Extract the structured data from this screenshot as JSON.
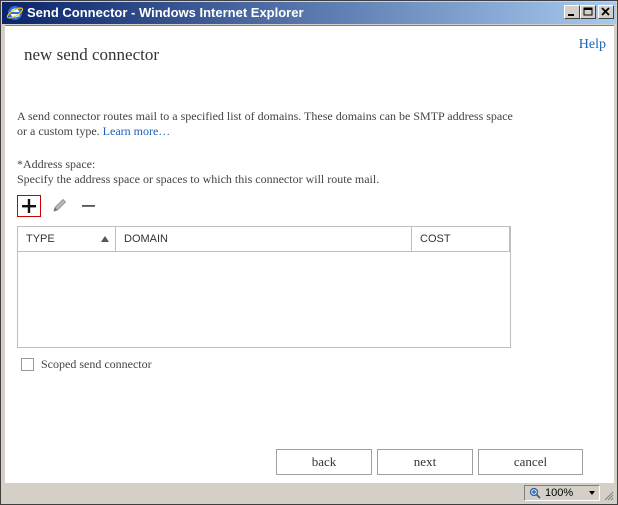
{
  "window": {
    "title": "Send Connector - Windows Internet Explorer"
  },
  "header": {
    "help_label": "Help",
    "page_title": "new send connector"
  },
  "description": {
    "text": "A send connector routes mail to a specified list of domains. These domains can be SMTP address space or a custom type. ",
    "link_label": "Learn more…"
  },
  "address_space": {
    "label": "*Address space:",
    "help": "Specify the address space or spaces to which this connector will route mail.",
    "toolbar": {
      "add_icon": "plus-icon",
      "edit_icon": "pencil-icon",
      "remove_icon": "minus-icon"
    },
    "columns": [
      "TYPE",
      "DOMAIN",
      "COST"
    ],
    "rows": []
  },
  "scoped": {
    "label": "Scoped send connector",
    "checked": false
  },
  "buttons": {
    "back": "back",
    "next": "next",
    "cancel": "cancel"
  },
  "statusbar": {
    "zoom": "100%"
  }
}
